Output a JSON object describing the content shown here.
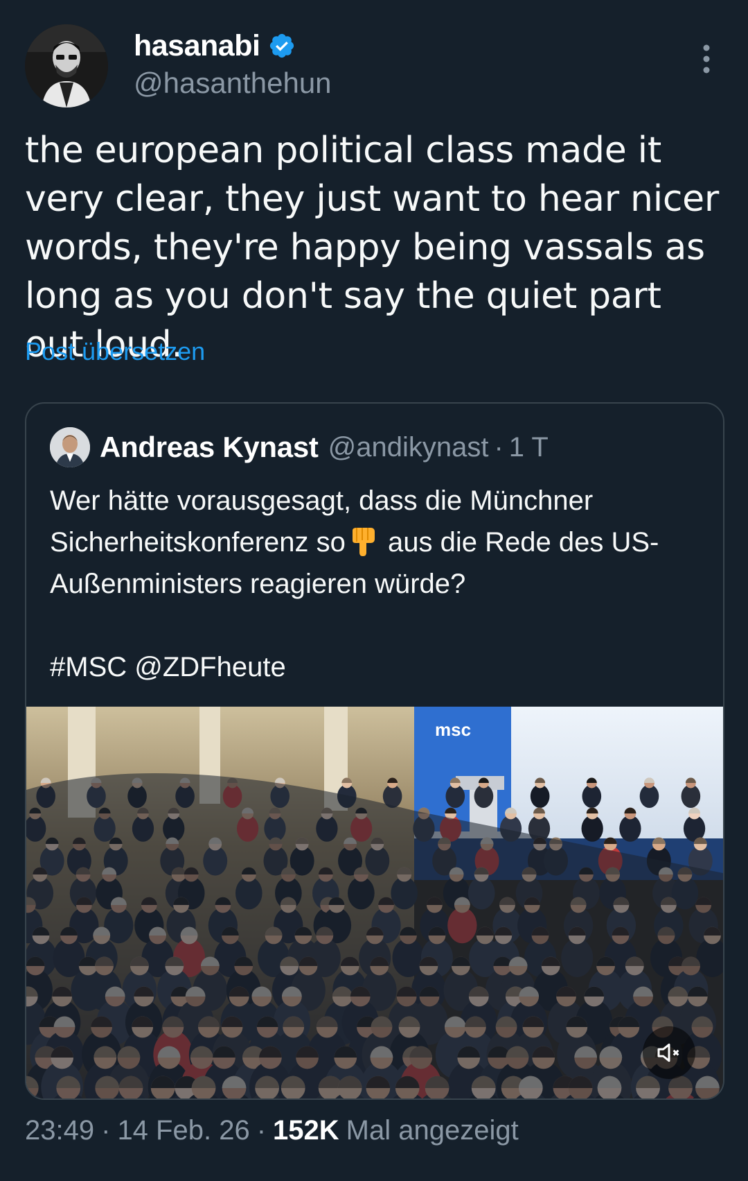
{
  "author": {
    "name": "hasanabi",
    "handle": "@hasanthehun",
    "verified": true,
    "verified_color": "#1d9bf0"
  },
  "tweet": {
    "text": "the european political class made it very clear, they just want to hear nicer words, they're happy being vassals as long as you don't say the quiet part out loud.",
    "translate_label": "Post übersetzen"
  },
  "quoted": {
    "name": "Andreas Kynast",
    "handle": "@andikynast",
    "separator": "·",
    "time": "1 T",
    "text_part1": "Wer hätte vorausgesagt, dass die Münchner Sicherheitskonferenz so",
    "emoji": "👇",
    "text_part2": " aus die Rede des US-Außenministers reagieren würde?",
    "tags": "#MSC @ZDFheute",
    "media": {
      "type": "video",
      "stage_logo": "msc",
      "icon": "speaker-muted-icon"
    }
  },
  "meta": {
    "time": "23:49",
    "sep1": "·",
    "date": "14 Feb. 26",
    "sep2": "·",
    "views": "152K",
    "views_label": "Mal angezeigt"
  },
  "colors": {
    "background": "#15202b",
    "text": "#f7f9f9",
    "secondary": "#8b98a5",
    "link": "#1d9bf0",
    "border": "#38444d"
  }
}
